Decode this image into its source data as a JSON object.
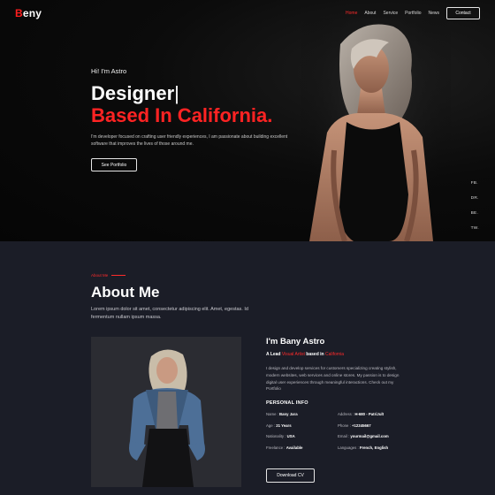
{
  "nav": {
    "logo_first": "B",
    "logo_rest": "eny",
    "items": [
      {
        "label": "Home",
        "active": true
      },
      {
        "label": "About",
        "active": false
      },
      {
        "label": "Service",
        "active": false
      },
      {
        "label": "Portfolio",
        "active": false
      },
      {
        "label": "News",
        "active": false
      }
    ],
    "contact_label": "Contact"
  },
  "hero": {
    "greeting": "Hi! I'm Astro",
    "headline_1": "Designer",
    "cursor": "|",
    "headline_2": "Based In California.",
    "description": "I'm developer focused on crafting user friendly experiences, I am passionate about building excellent software that improves the lives of those around me.",
    "button_label": "See Portfolio",
    "social": [
      "FB.",
      "DR.",
      "BE.",
      "TW."
    ]
  },
  "about": {
    "eyebrow": "About Me",
    "title": "About Me",
    "lead": "Lorem ipsum dolor sit amet, consectetur adipiscing elit. Amet, egestas. Id fermentum nullam ipsum massa.",
    "name": "I'm Bany Astro",
    "role_prefix": "A Lead ",
    "role_highlight": "Visual Artist",
    "role_mid": " based in ",
    "role_location": "California",
    "bio": "I design and develop services for customers specializing creating stylish, modern websites, web services and online stores. My passion is to design digital user experiences through meaningful interactions. Check out my Portfolio",
    "personal_info_title": "PERSONAL INFO",
    "info": [
      {
        "label": "Name : ",
        "value": "Bany Jara"
      },
      {
        "label": "Address : ",
        "value": "H-680 - PatriJult"
      },
      {
        "label": "Age : ",
        "value": "21 Years"
      },
      {
        "label": "Phone : ",
        "value": "+12345667"
      },
      {
        "label": "Nationality : ",
        "value": "USA"
      },
      {
        "label": "Email : ",
        "value": "yourmail@gmail.com"
      },
      {
        "label": "Freelance : ",
        "value": "Available"
      },
      {
        "label": "Languages : ",
        "value": "French, English"
      }
    ],
    "cv_button": "Download CV"
  },
  "colors": {
    "accent": "#ff2323",
    "hero_bg": "#0a0a0a",
    "section_bg": "#1b1d27"
  }
}
